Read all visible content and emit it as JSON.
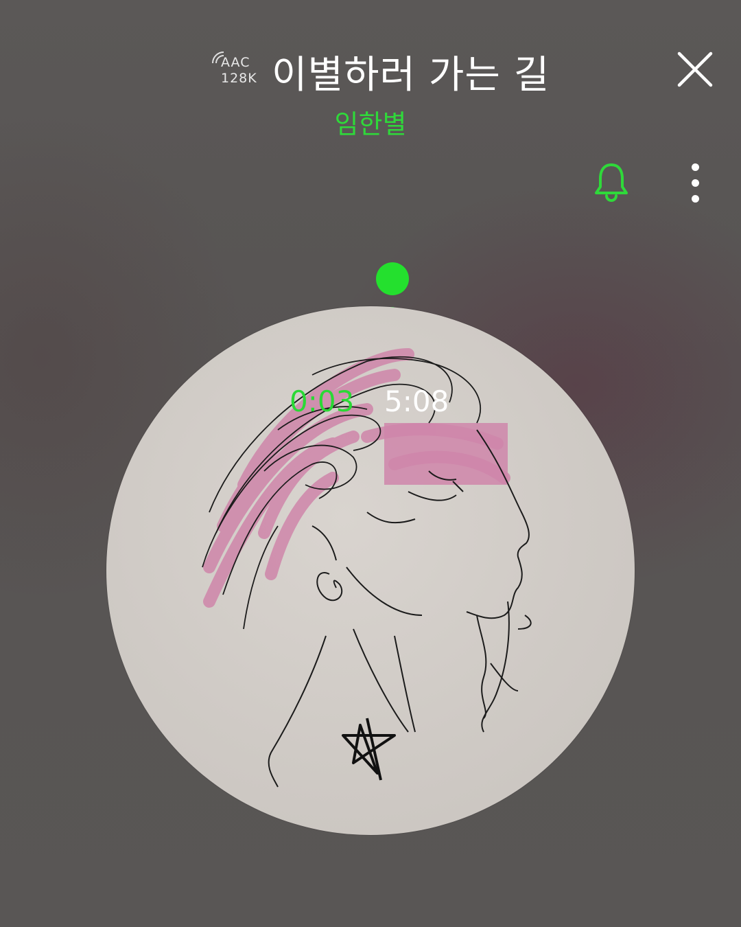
{
  "player": {
    "quality_codec": "AAC",
    "quality_bitrate": "128K",
    "title": "이별하러 가는 길",
    "artist": "임한별",
    "time_elapsed": "0:03",
    "time_total": "5:08",
    "progress_fraction": 0.01
  },
  "icons": {
    "close": "close-icon",
    "bell": "bell-icon",
    "more": "more-vertical-icon",
    "wave": "signal-wave-icon"
  },
  "colors": {
    "accent": "#2fd93a",
    "background": "#5a5756",
    "text": "#ffffff"
  }
}
